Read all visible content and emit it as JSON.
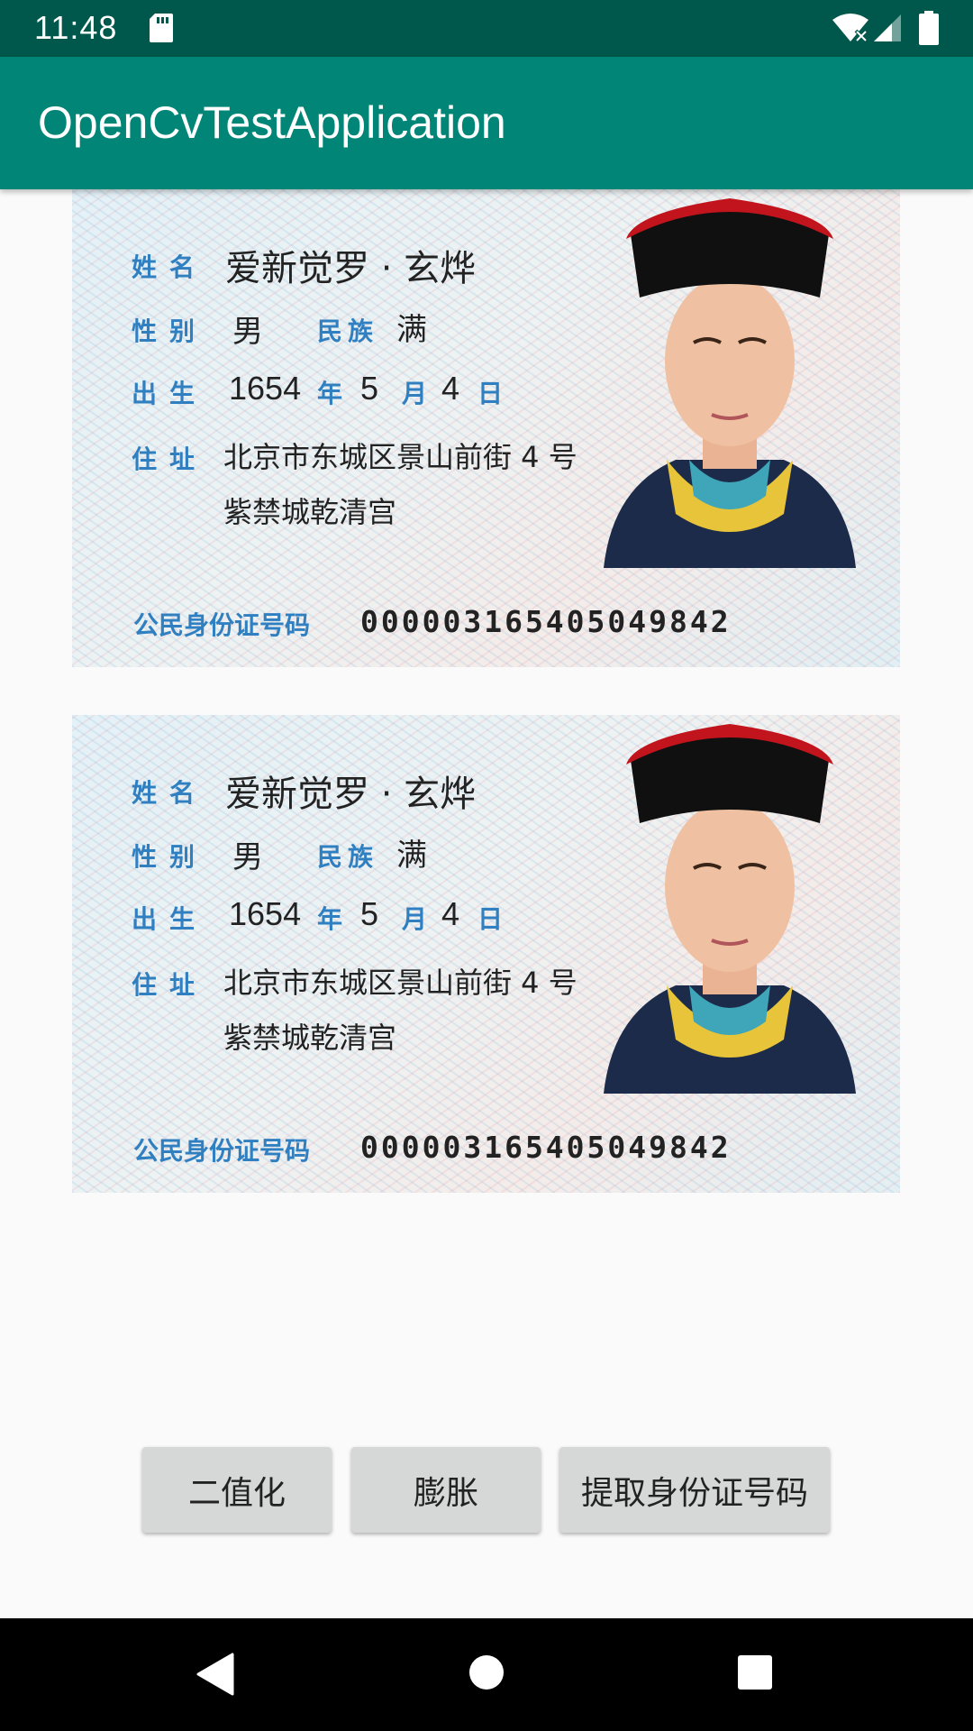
{
  "status_bar": {
    "time": "11:48",
    "icons": [
      "sd-card-icon",
      "wifi-icon",
      "signal-icon",
      "battery-icon"
    ]
  },
  "app_bar": {
    "title": "OpenCvTestApplication",
    "color": "#008577"
  },
  "id_cards": [
    {
      "name_label": "姓名",
      "name": "爱新觉罗 · 玄烨",
      "sex_label": "性别",
      "sex": "男",
      "ethnic_label": "民族",
      "ethnic": "满",
      "birth_label": "出生",
      "birth_year": "1654",
      "year_unit": "年",
      "birth_month": "5",
      "month_unit": "月",
      "birth_day": "4",
      "day_unit": "日",
      "address_label": "住址",
      "address_line1": "北京市东城区景山前街 4 号",
      "address_line2": "紫禁城乾清宫",
      "id_label": "公民身份证号码",
      "id_number": "000003165405049842"
    },
    {
      "name_label": "姓名",
      "name": "爱新觉罗 · 玄烨",
      "sex_label": "性别",
      "sex": "男",
      "ethnic_label": "民族",
      "ethnic": "满",
      "birth_label": "出生",
      "birth_year": "1654",
      "year_unit": "年",
      "birth_month": "5",
      "month_unit": "月",
      "birth_day": "4",
      "day_unit": "日",
      "address_label": "住址",
      "address_line1": "北京市东城区景山前街 4 号",
      "address_line2": "紫禁城乾清宫",
      "id_label": "公民身份证号码",
      "id_number": "000003165405049842"
    }
  ],
  "buttons": {
    "binarize": "二值化",
    "dilate": "膨胀",
    "extract_id": "提取身份证号码"
  },
  "nav_bar": {
    "icons": [
      "back-icon",
      "home-icon",
      "recent-apps-icon"
    ]
  }
}
